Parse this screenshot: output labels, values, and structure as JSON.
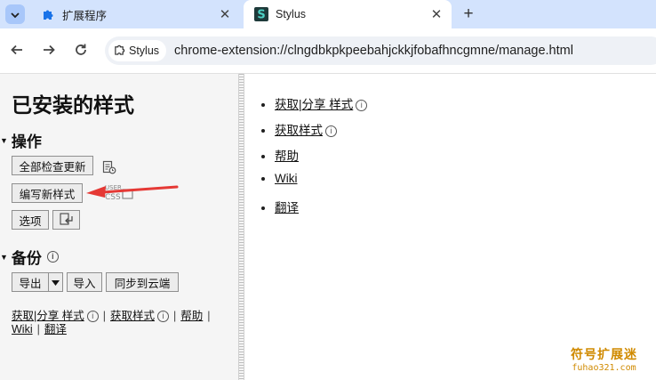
{
  "browser": {
    "tabs": [
      {
        "title": "扩展程序",
        "favicon": "puzzle-icon",
        "active": false
      },
      {
        "title": "Stylus",
        "favicon": "stylus-logo-icon",
        "active": true
      }
    ],
    "site_chip": "Stylus",
    "url": "chrome-extension://clngdbkpkpeebahjckkjfobafhncgmne/manage.html",
    "accent": "#d3e3fd"
  },
  "page": {
    "title": "已安装的样式",
    "actions": {
      "heading": "操作",
      "check_all_updates": "全部检查更新",
      "write_new_style": "编写新样式",
      "options": "选项"
    },
    "backup": {
      "heading": "备份",
      "export": "导出",
      "import": "导入",
      "sync": "同步到云端"
    },
    "sidebar_links": {
      "get_share": "获取|分享 样式",
      "get_styles": "获取样式",
      "help": "帮助",
      "wiki": "Wiki",
      "translate": "翻译"
    },
    "help_list": [
      "获取|分享 样式",
      "获取样式",
      "帮助",
      "Wiki",
      "翻译"
    ],
    "arrow_color": "#e53935"
  },
  "watermark": {
    "title": "符号扩展迷",
    "site": "fuhao321.com"
  }
}
